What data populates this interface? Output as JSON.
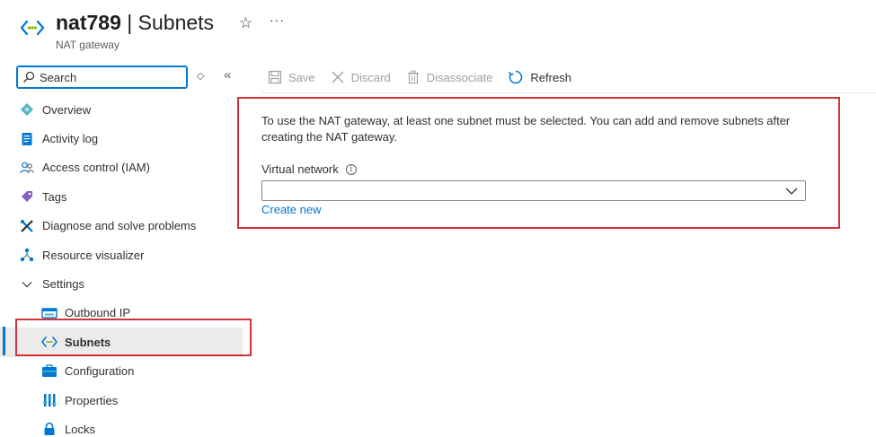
{
  "header": {
    "resource_name": "nat789",
    "separator": " | ",
    "page_name": "Subnets",
    "subtitle": "NAT gateway",
    "favorite_icon": "star-icon",
    "more_icon": "ellipsis-icon"
  },
  "search": {
    "placeholder": "Search"
  },
  "toolbar": {
    "save_label": "Save",
    "discard_label": "Discard",
    "disassociate_label": "Disassociate",
    "refresh_label": "Refresh"
  },
  "sidebar": {
    "items": [
      {
        "label": "Overview",
        "icon": "overview-icon"
      },
      {
        "label": "Activity log",
        "icon": "activity-log-icon"
      },
      {
        "label": "Access control (IAM)",
        "icon": "people-icon"
      },
      {
        "label": "Tags",
        "icon": "tag-icon"
      },
      {
        "label": "Diagnose and solve problems",
        "icon": "wrench-icon"
      },
      {
        "label": "Resource visualizer",
        "icon": "visualizer-icon"
      },
      {
        "label": "Settings",
        "icon": "chevron-down-icon"
      },
      {
        "label": "Outbound IP",
        "icon": "outbound-ip-icon"
      },
      {
        "label": "Subnets",
        "icon": "subnets-icon",
        "selected": true
      },
      {
        "label": "Configuration",
        "icon": "configuration-icon"
      },
      {
        "label": "Properties",
        "icon": "properties-icon"
      },
      {
        "label": "Locks",
        "icon": "lock-icon"
      }
    ]
  },
  "main": {
    "info_text": "To use the NAT gateway, at least one subnet must be selected. You can add and remove subnets after creating the NAT gateway.",
    "virtual_network_label": "Virtual network",
    "virtual_network_value": "",
    "create_new_label": "Create new"
  },
  "colors": {
    "accent": "#0078d4",
    "highlight_box": "#d13438",
    "selected_bg": "#edebe9"
  }
}
